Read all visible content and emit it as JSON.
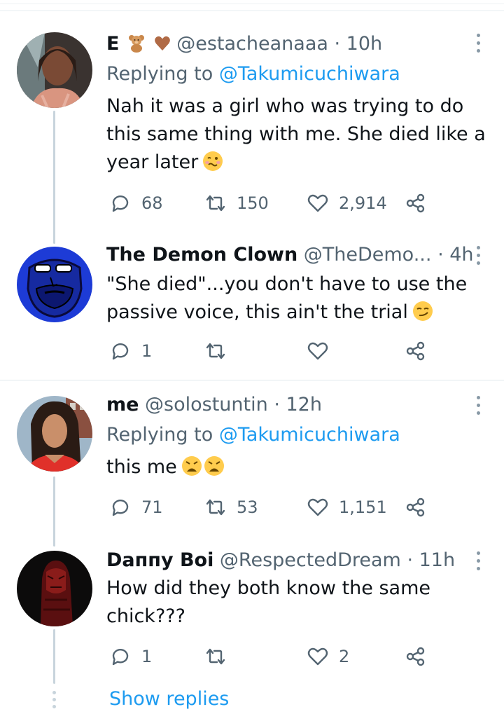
{
  "colors": {
    "text": "#0f1419",
    "secondary": "#536471",
    "link": "#1d9bf0",
    "divider": "#e1e8ed"
  },
  "tweets": [
    {
      "name": "E",
      "name_emojis": [
        "teddy-bear-emoji",
        "brown-heart-emoji"
      ],
      "handle": "@estacheanaaa",
      "time": "· 10h",
      "replying_label": "Replying to",
      "replying_to": "@Takumicuchiwara",
      "text": "Nah it was a girl who was trying to do this same thing with me. She died like a year later",
      "text_emoji": "woozy-face-emoji",
      "replies": "68",
      "retweets": "150",
      "likes": "2,914"
    },
    {
      "name": "The Demon Clown",
      "handle": "@TheDemo...",
      "time": "· 4h",
      "text": "\"She died\"...you don't have to use the passive voice, this ain't the trial",
      "text_emoji": "smirking-face-emoji",
      "replies": "1",
      "retweets": "",
      "likes": ""
    },
    {
      "name": "me",
      "handle": "@solostuntin",
      "time": "· 12h",
      "replying_label": "Replying to",
      "replying_to": "@Takumicuchiwara",
      "text": "this me",
      "text_emoji": "weary-face-emoji",
      "replies": "71",
      "retweets": "53",
      "likes": "1,151"
    },
    {
      "name": "Dаппу Boi",
      "handle": "@RespectedDream",
      "time": "· 11h",
      "text": "How did they both know the same chick???",
      "replies": "1",
      "retweets": "",
      "likes": "2"
    }
  ],
  "show_replies": "Show replies"
}
